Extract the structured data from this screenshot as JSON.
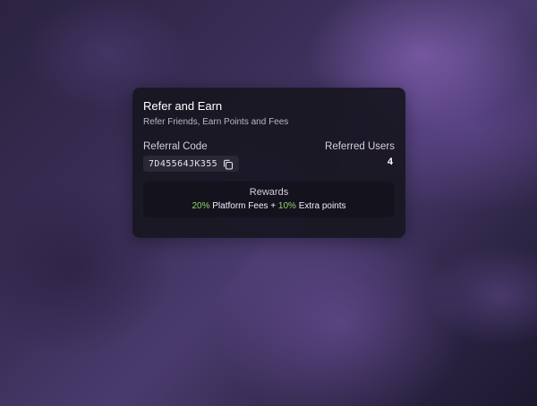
{
  "card": {
    "title": "Refer and Earn",
    "subtitle": "Refer Friends, Earn Points and Fees"
  },
  "referral": {
    "code_label": "Referral Code",
    "code": "7D45564JK355",
    "copy_icon": "copy-icon"
  },
  "referred": {
    "label": "Referred Users",
    "count": "4"
  },
  "rewards": {
    "title": "Rewards",
    "fee_percent": "20%",
    "fee_text": " Platform Fees + ",
    "points_percent": "10%",
    "points_text": " Extra points"
  },
  "colors": {
    "accent_green": "#8fd46a",
    "card_bg": "#181622"
  }
}
